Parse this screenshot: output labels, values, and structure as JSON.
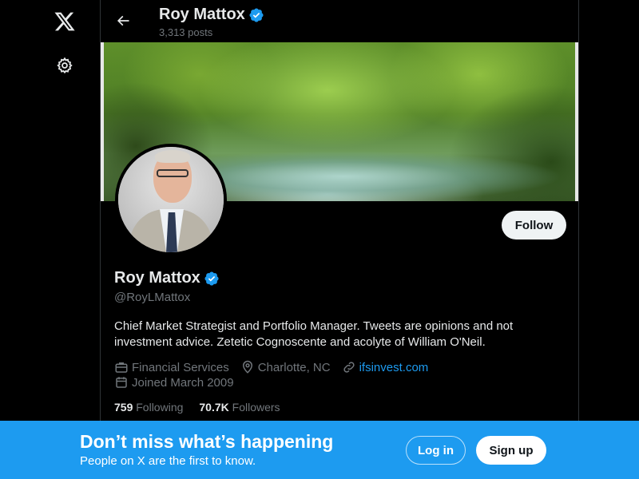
{
  "nav": {
    "logo_icon": "x-logo-icon",
    "settings_icon": "gear-icon"
  },
  "header": {
    "name": "Roy Mattox",
    "posts": "3,313 posts",
    "back_icon": "arrow-left-icon"
  },
  "profile": {
    "name": "Roy Mattox",
    "handle": "@RoyLMattox",
    "verified_icon": "verified-badge-icon",
    "follow_label": "Follow",
    "bio": "Chief Market Strategist and Portfolio Manager. Tweets are opinions and not investment advice.  Zetetic Cognoscente and acolyte of William O'Neil.",
    "category": "Financial Services",
    "location": "Charlotte, NC",
    "website": "ifsinvest.com",
    "joined": "Joined March 2009",
    "following_count": "759",
    "following_label": "Following",
    "followers_count": "70.7K",
    "followers_label": "Followers"
  },
  "signup_bar": {
    "title": "Don’t miss what’s happening",
    "subtitle": "People on X are the first to know.",
    "login_label": "Log in",
    "signup_label": "Sign up"
  },
  "colors": {
    "accent": "#1d9bf0",
    "background": "#000000",
    "muted": "#71767b"
  }
}
